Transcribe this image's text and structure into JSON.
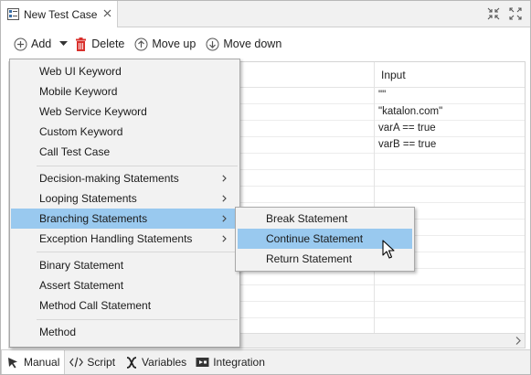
{
  "tab": {
    "title": "New Test Case",
    "close_icon": "close-icon"
  },
  "toolbar": {
    "add_label": "Add",
    "delete_label": "Delete",
    "move_up_label": "Move up",
    "move_down_label": "Move down"
  },
  "table": {
    "input_header": "Input",
    "rows": [
      "\"\"",
      "",
      "\"katalon.com\"",
      "varA == true",
      "varB == true"
    ]
  },
  "menu": {
    "items": [
      "Web UI Keyword",
      "Mobile Keyword",
      "Web Service Keyword",
      "Custom Keyword",
      "Call Test Case",
      "Decision-making Statements",
      "Looping Statements",
      "Branching Statements",
      "Exception Handling Statements",
      "Binary Statement",
      "Assert Statement",
      "Method Call Statement",
      "Method"
    ],
    "highlighted": "Branching Statements"
  },
  "submenu": {
    "items": [
      "Break Statement",
      "Continue Statement",
      "Return Statement"
    ],
    "highlighted": "Continue Statement"
  },
  "bottom_tabs": {
    "manual": "Manual",
    "script": "Script",
    "variables": "Variables",
    "integration": "Integration",
    "active": "Manual"
  },
  "colors": {
    "highlight": "#99c9ef",
    "delete_red": "#d9302c",
    "tab_icon_blue": "#3a6ea5"
  }
}
